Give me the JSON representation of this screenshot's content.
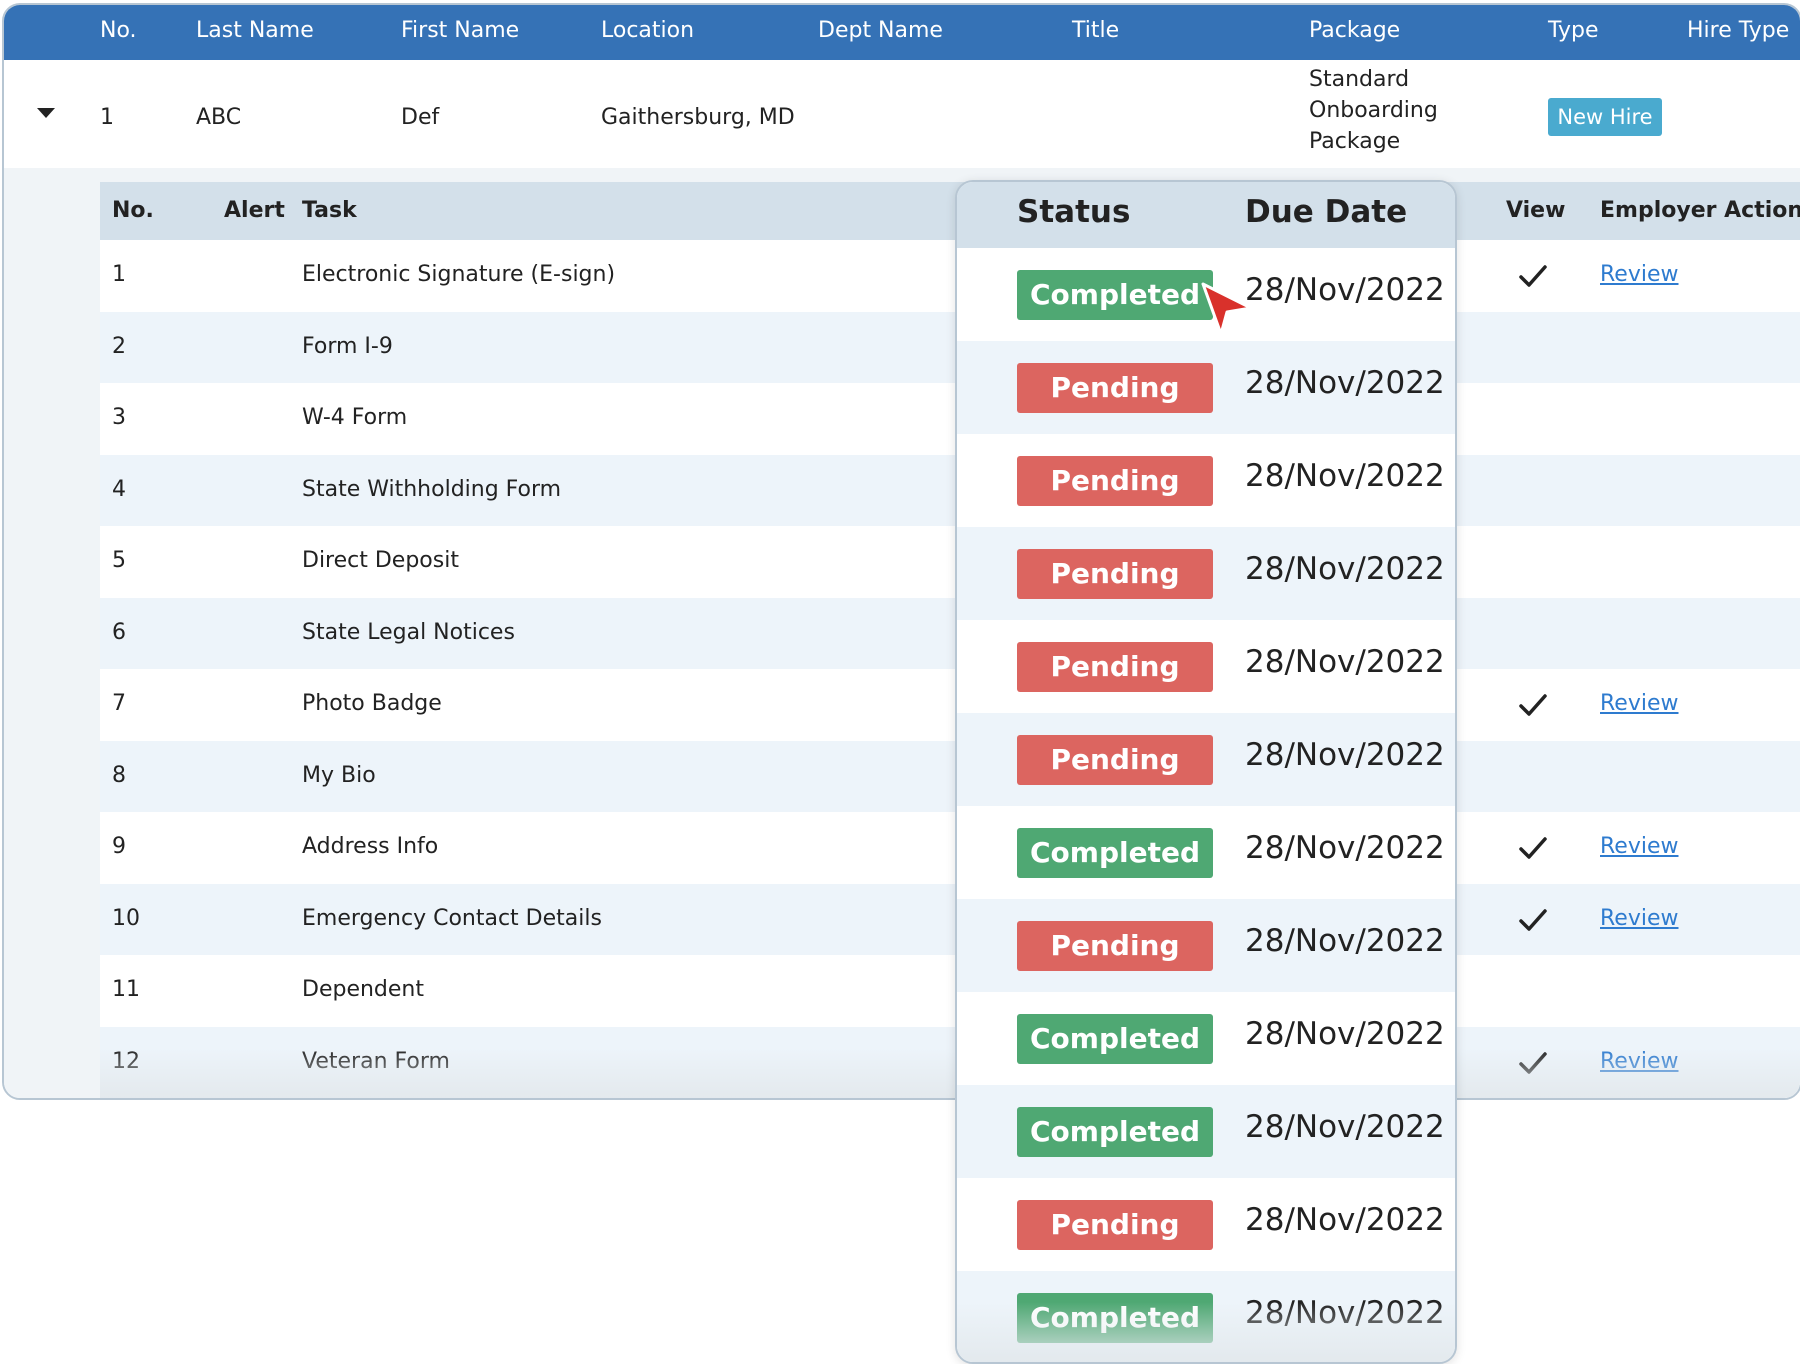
{
  "main_header": {
    "no": "No.",
    "last_name": "Last Name",
    "first_name": "First Name",
    "location": "Location",
    "dept_name": "Dept Name",
    "title": "Title",
    "package": "Package",
    "type": "Type",
    "hire_type": "Hire Type"
  },
  "employee": {
    "no": "1",
    "last_name": "ABC",
    "first_name": "Def",
    "location": "Gaithersburg, MD",
    "package_lines": [
      "Standard",
      "Onboarding",
      "Package"
    ],
    "type_badge": "New Hire"
  },
  "sub_header": {
    "no": "No.",
    "alert": "Alert",
    "task": "Task",
    "view": "View",
    "employer_action": "Employer Action"
  },
  "tasks": [
    {
      "no": "1",
      "task": "Electronic Signature (E-sign)",
      "viewed": true,
      "action": "Review"
    },
    {
      "no": "2",
      "task": "Form I-9",
      "viewed": false,
      "action": ""
    },
    {
      "no": "3",
      "task": "W-4 Form",
      "viewed": false,
      "action": ""
    },
    {
      "no": "4",
      "task": "State Withholding Form",
      "viewed": false,
      "action": ""
    },
    {
      "no": "5",
      "task": "Direct Deposit",
      "viewed": false,
      "action": ""
    },
    {
      "no": "6",
      "task": "State Legal Notices",
      "viewed": false,
      "action": ""
    },
    {
      "no": "7",
      "task": "Photo Badge",
      "viewed": true,
      "action": "Review"
    },
    {
      "no": "8",
      "task": "My Bio",
      "viewed": false,
      "action": ""
    },
    {
      "no": "9",
      "task": "Address Info",
      "viewed": true,
      "action": "Review"
    },
    {
      "no": "10",
      "task": "Emergency Contact Details",
      "viewed": true,
      "action": "Review"
    },
    {
      "no": "11",
      "task": "Dependent",
      "viewed": false,
      "action": ""
    },
    {
      "no": "12",
      "task": "Veteran Form",
      "viewed": true,
      "action": "Review"
    }
  ],
  "status_panel": {
    "status_header": "Status",
    "due_header": "Due Date",
    "rows": [
      {
        "status": "Completed",
        "due": "28/Nov/2022"
      },
      {
        "status": "Pending",
        "due": "28/Nov/2022"
      },
      {
        "status": "Pending",
        "due": "28/Nov/2022"
      },
      {
        "status": "Pending",
        "due": "28/Nov/2022"
      },
      {
        "status": "Pending",
        "due": "28/Nov/2022"
      },
      {
        "status": "Pending",
        "due": "28/Nov/2022"
      },
      {
        "status": "Completed",
        "due": "28/Nov/2022"
      },
      {
        "status": "Pending",
        "due": "28/Nov/2022"
      },
      {
        "status": "Completed",
        "due": "28/Nov/2022"
      },
      {
        "status": "Completed",
        "due": "28/Nov/2022"
      },
      {
        "status": "Pending",
        "due": "28/Nov/2022"
      },
      {
        "status": "Completed",
        "due": "28/Nov/2022"
      }
    ]
  },
  "colors": {
    "header_blue": "#3572b6",
    "completed_green": "#4fa873",
    "pending_red": "#dc6560",
    "new_hire_badge": "#4aaacf",
    "link_blue": "#2e7bcf",
    "cursor_red": "#d9312b"
  },
  "icons": {
    "expand": "chevron-down-icon",
    "viewed": "checkmark-icon",
    "pointer": "cursor-arrow-icon"
  }
}
